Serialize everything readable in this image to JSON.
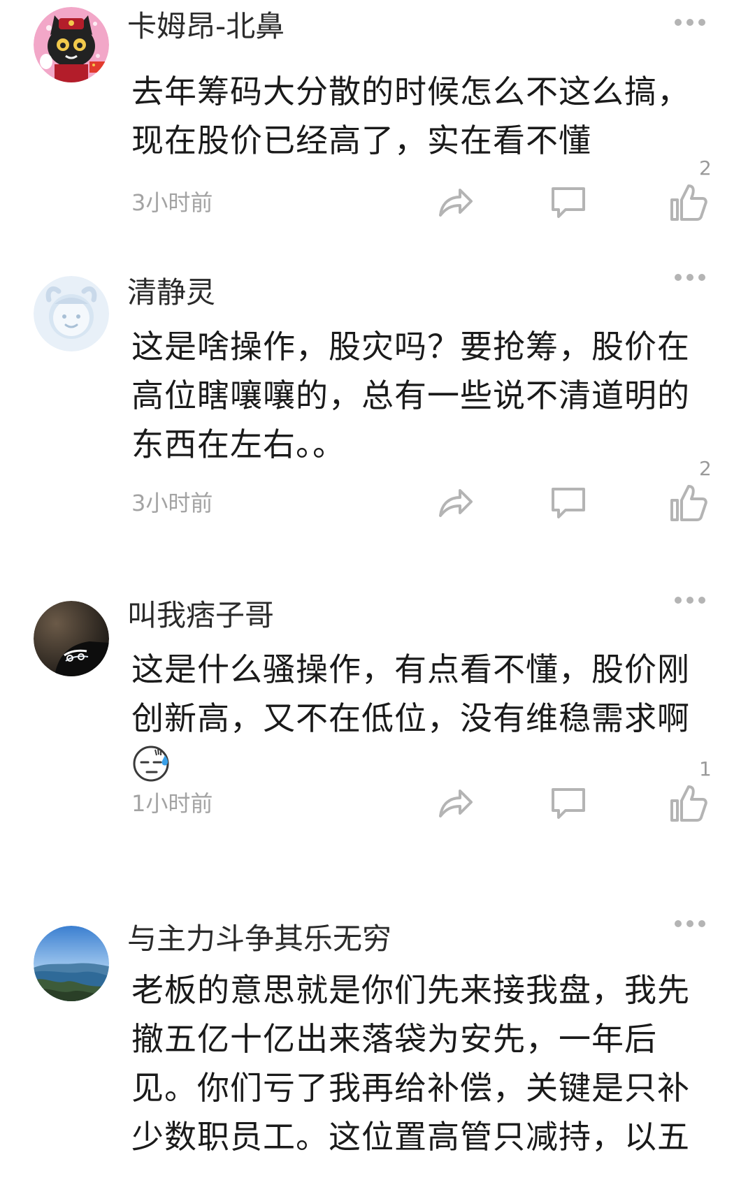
{
  "comments": [
    {
      "username": "卡姆昂-北鼻",
      "avatar": "cartoon-cat-avatar",
      "lines": [
        "去年筹码大分散的时候怎么不这么搞，",
        "现在股价已经高了，实在看不懂"
      ],
      "time": "3小时前",
      "likes": "2"
    },
    {
      "username": "清静灵",
      "avatar": "default-cow-avatar",
      "lines": [
        "这是啥操作，股灾吗？要抢筹，股价在",
        "高位瞎嚷嚷的，总有一些说不清道明的",
        "东西在左右。。"
      ],
      "time": "3小时前",
      "likes": "2"
    },
    {
      "username": "叫我痞子哥",
      "avatar": "car-headlight-avatar",
      "lines": [
        "这是什么骚操作，有点看不懂，股价刚",
        "创新高，又不在低位，没有维稳需求啊"
      ],
      "emoji": "sweat-emoji",
      "time": "1小时前",
      "likes": "1"
    },
    {
      "username": "与主力斗争其乐无穷",
      "avatar": "lake-landscape-avatar",
      "lines": [
        "老板的意思就是你们先来接我盘，我先",
        "撤五亿十亿出来落袋为安先，一年后",
        "见。你们亏了我再给补偿，关键是只补",
        "少数职员工。这位置高管只减持，以五"
      ]
    }
  ],
  "icons": {
    "more": "more-dots-icon",
    "share": "share-arrow-icon",
    "reply": "comment-bubble-icon",
    "like": "thumbs-up-icon"
  },
  "colors": {
    "text": "#1a1a1a",
    "meta": "#a3a3a3",
    "icon": "#b4b4b4"
  }
}
